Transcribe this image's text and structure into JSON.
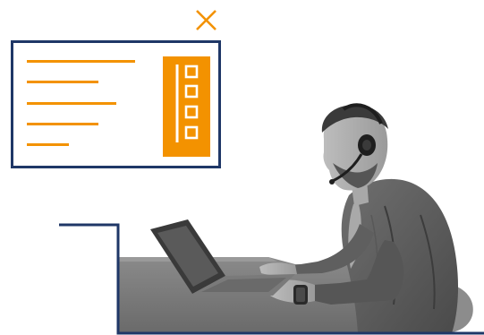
{
  "colors": {
    "accent": "#F39200",
    "frame": "#1F3767",
    "background": "#FFFFFF",
    "photo_base": "#7D7D7D"
  },
  "card": {
    "text_lines": 5,
    "checklist_items": 4,
    "icon": "document-with-checklist-icon"
  },
  "close": {
    "icon": "close-icon"
  },
  "photo": {
    "subject": "person-with-headset-at-laptop",
    "style": "grayscale"
  }
}
